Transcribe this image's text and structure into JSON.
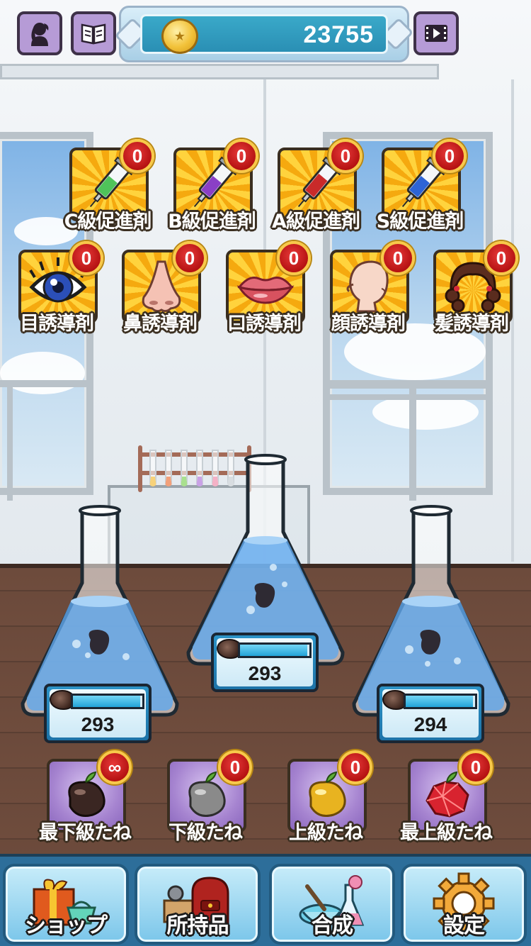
{
  "topbar": {
    "icons": [
      "girl-silhouette-icon",
      "book-icon",
      "video-icon"
    ],
    "coins": "23755"
  },
  "promoters": [
    {
      "label": "C級促進剤",
      "count": "0",
      "icon": "syringe-green-icon",
      "color": "#4fc35a"
    },
    {
      "label": "B級促進剤",
      "count": "0",
      "icon": "syringe-purple-icon",
      "color": "#8a3fc6"
    },
    {
      "label": "A級促進剤",
      "count": "0",
      "icon": "syringe-red-icon",
      "color": "#c92a2a"
    },
    {
      "label": "S級促進剤",
      "count": "0",
      "icon": "syringe-blue-icon",
      "color": "#2d64d6"
    }
  ],
  "inducers": [
    {
      "label": "目誘導剤",
      "count": "0",
      "icon": "eye-icon"
    },
    {
      "label": "鼻誘導剤",
      "count": "0",
      "icon": "nose-icon"
    },
    {
      "label": "口誘導剤",
      "count": "0",
      "icon": "lips-icon"
    },
    {
      "label": "顔誘導剤",
      "count": "0",
      "icon": "face-icon"
    },
    {
      "label": "髪誘導剤",
      "count": "0",
      "icon": "hair-icon"
    }
  ],
  "flasks": [
    {
      "value": "293",
      "fill": 0.97
    },
    {
      "value": "293",
      "fill": 0.97
    },
    {
      "value": "294",
      "fill": 0.97
    }
  ],
  "seeds": [
    {
      "label": "最下級たね",
      "count": "∞",
      "icon": "dark-bean-icon"
    },
    {
      "label": "下級たね",
      "count": "0",
      "icon": "gray-bean-icon"
    },
    {
      "label": "上級たね",
      "count": "0",
      "icon": "gold-bean-icon"
    },
    {
      "label": "最上級たね",
      "count": "0",
      "icon": "ruby-bean-icon"
    }
  ],
  "nav": [
    {
      "label": "ショップ",
      "icon": "shop-icon"
    },
    {
      "label": "所持品",
      "icon": "bag-icon"
    },
    {
      "label": "合成",
      "icon": "flask-synthesis-icon"
    },
    {
      "label": "設定",
      "icon": "gear-icon"
    }
  ]
}
